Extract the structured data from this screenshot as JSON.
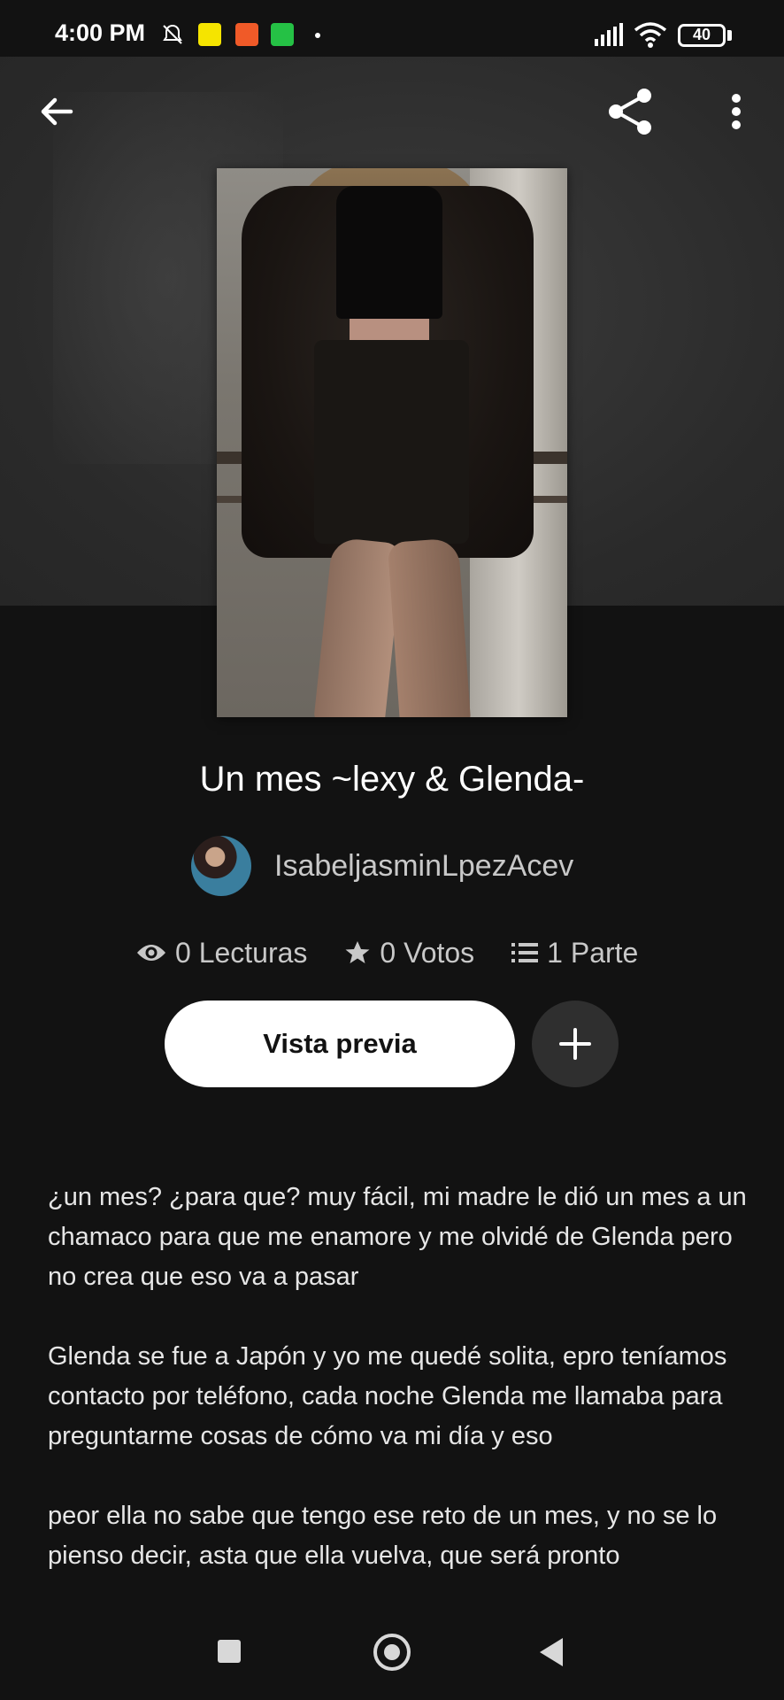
{
  "status_bar": {
    "time": "4:00 PM",
    "battery": "40",
    "icons": [
      "bell-muted-icon",
      "app-notification-icon",
      "app-notification-icon",
      "whatsapp-icon",
      "dot-icon",
      "signal-icon",
      "wifi-icon",
      "battery-icon"
    ],
    "colors": {
      "app1": "#f5e400",
      "app2": "#f05a28",
      "whatsapp": "#25c145"
    }
  },
  "toolbar": {
    "back_icon": "arrow-left-icon",
    "share_icon": "share-icon",
    "more_icon": "more-vertical-icon"
  },
  "story": {
    "title": "Un mes ~lexy & Glenda-",
    "author": "IsabeljasminLpezAcev"
  },
  "stats": {
    "reads": "0 Lecturas",
    "votes": "0 Votos",
    "parts": "1 Parte"
  },
  "actions": {
    "preview_label": "Vista previa",
    "add_icon": "plus-icon"
  },
  "description": {
    "paragraphs": [
      "¿un mes? ¿para que? muy fácil, mi madre le dió un mes a un chamaco para que me enamore y me olvidé de Glenda pero no crea que eso va a pasar",
      "Glenda se fue a Japón y yo me quedé solita, epro teníamos contacto por teléfono, cada noche Glenda me llamaba para preguntarme cosas de cómo va mi día y eso",
      "peor ella no sabe que tengo ese reto de un mes, y no se lo pienso decir, asta que ella vuelva, que será pronto"
    ]
  },
  "nav_bar": {
    "icons": [
      "recent-apps-icon",
      "home-icon",
      "back-triangle-icon"
    ]
  }
}
